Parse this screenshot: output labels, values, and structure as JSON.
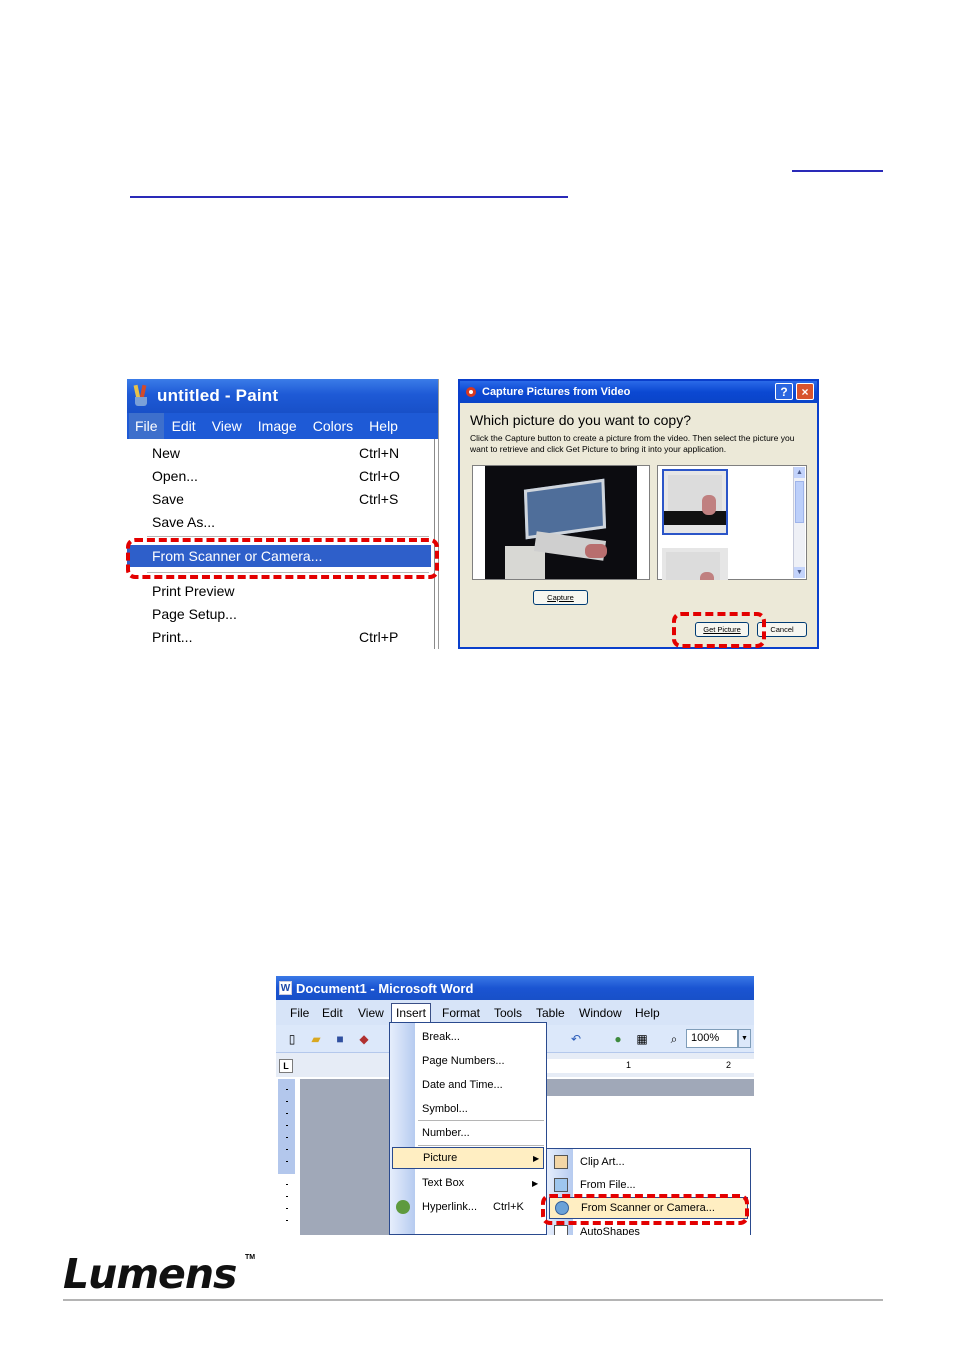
{
  "paint": {
    "title": "untitled - Paint",
    "menu": [
      "File",
      "Edit",
      "View",
      "Image",
      "Colors",
      "Help"
    ],
    "items": [
      {
        "label": "New",
        "shortcut": "Ctrl+N"
      },
      {
        "label": "Open...",
        "shortcut": "Ctrl+O"
      },
      {
        "label": "Save",
        "shortcut": "Ctrl+S"
      },
      {
        "label": "Save As...",
        "shortcut": ""
      },
      {
        "label": "From Scanner or Camera...",
        "shortcut": ""
      },
      {
        "label": "Print Preview",
        "shortcut": ""
      },
      {
        "label": "Page Setup...",
        "shortcut": ""
      },
      {
        "label": "Print...",
        "shortcut": "Ctrl+P"
      }
    ]
  },
  "capture": {
    "title": "Capture Pictures from Video",
    "help_btn": "?",
    "close_btn": "×",
    "question": "Which picture do you want to copy?",
    "instructions": "Click the Capture button to create a picture from the video.  Then select the picture you want to retrieve and click Get Picture to bring it into your application.",
    "capture_btn": "Capture",
    "get_picture_btn": "Get Picture",
    "cancel_btn": "Cancel"
  },
  "word": {
    "title": "Document1 - Microsoft Word",
    "menu": [
      "File",
      "Edit",
      "View",
      "Insert",
      "Format",
      "Tools",
      "Table",
      "Window",
      "Help"
    ],
    "zoom": "100%",
    "ruler_marks": [
      "1",
      "2"
    ],
    "insert_items": [
      {
        "label": "Break...",
        "shortcut": ""
      },
      {
        "label": "Page Numbers...",
        "shortcut": ""
      },
      {
        "label": "Date and Time...",
        "shortcut": ""
      },
      {
        "label": "Symbol...",
        "shortcut": ""
      },
      {
        "label": "Number...",
        "shortcut": ""
      },
      {
        "label": "Picture",
        "shortcut": ""
      },
      {
        "label": "Text Box",
        "shortcut": ""
      },
      {
        "label": "Hyperlink...",
        "shortcut": "Ctrl+K"
      }
    ],
    "picture_items": [
      "Clip Art...",
      "From File...",
      "From Scanner or Camera...",
      "AutoShapes"
    ]
  },
  "footer": {
    "logo": "Lumens",
    "tm": "TM"
  },
  "colors": {
    "highlight": "#e30000",
    "xp_blue": "#1e5ad6",
    "link": "#2a2ab8"
  }
}
